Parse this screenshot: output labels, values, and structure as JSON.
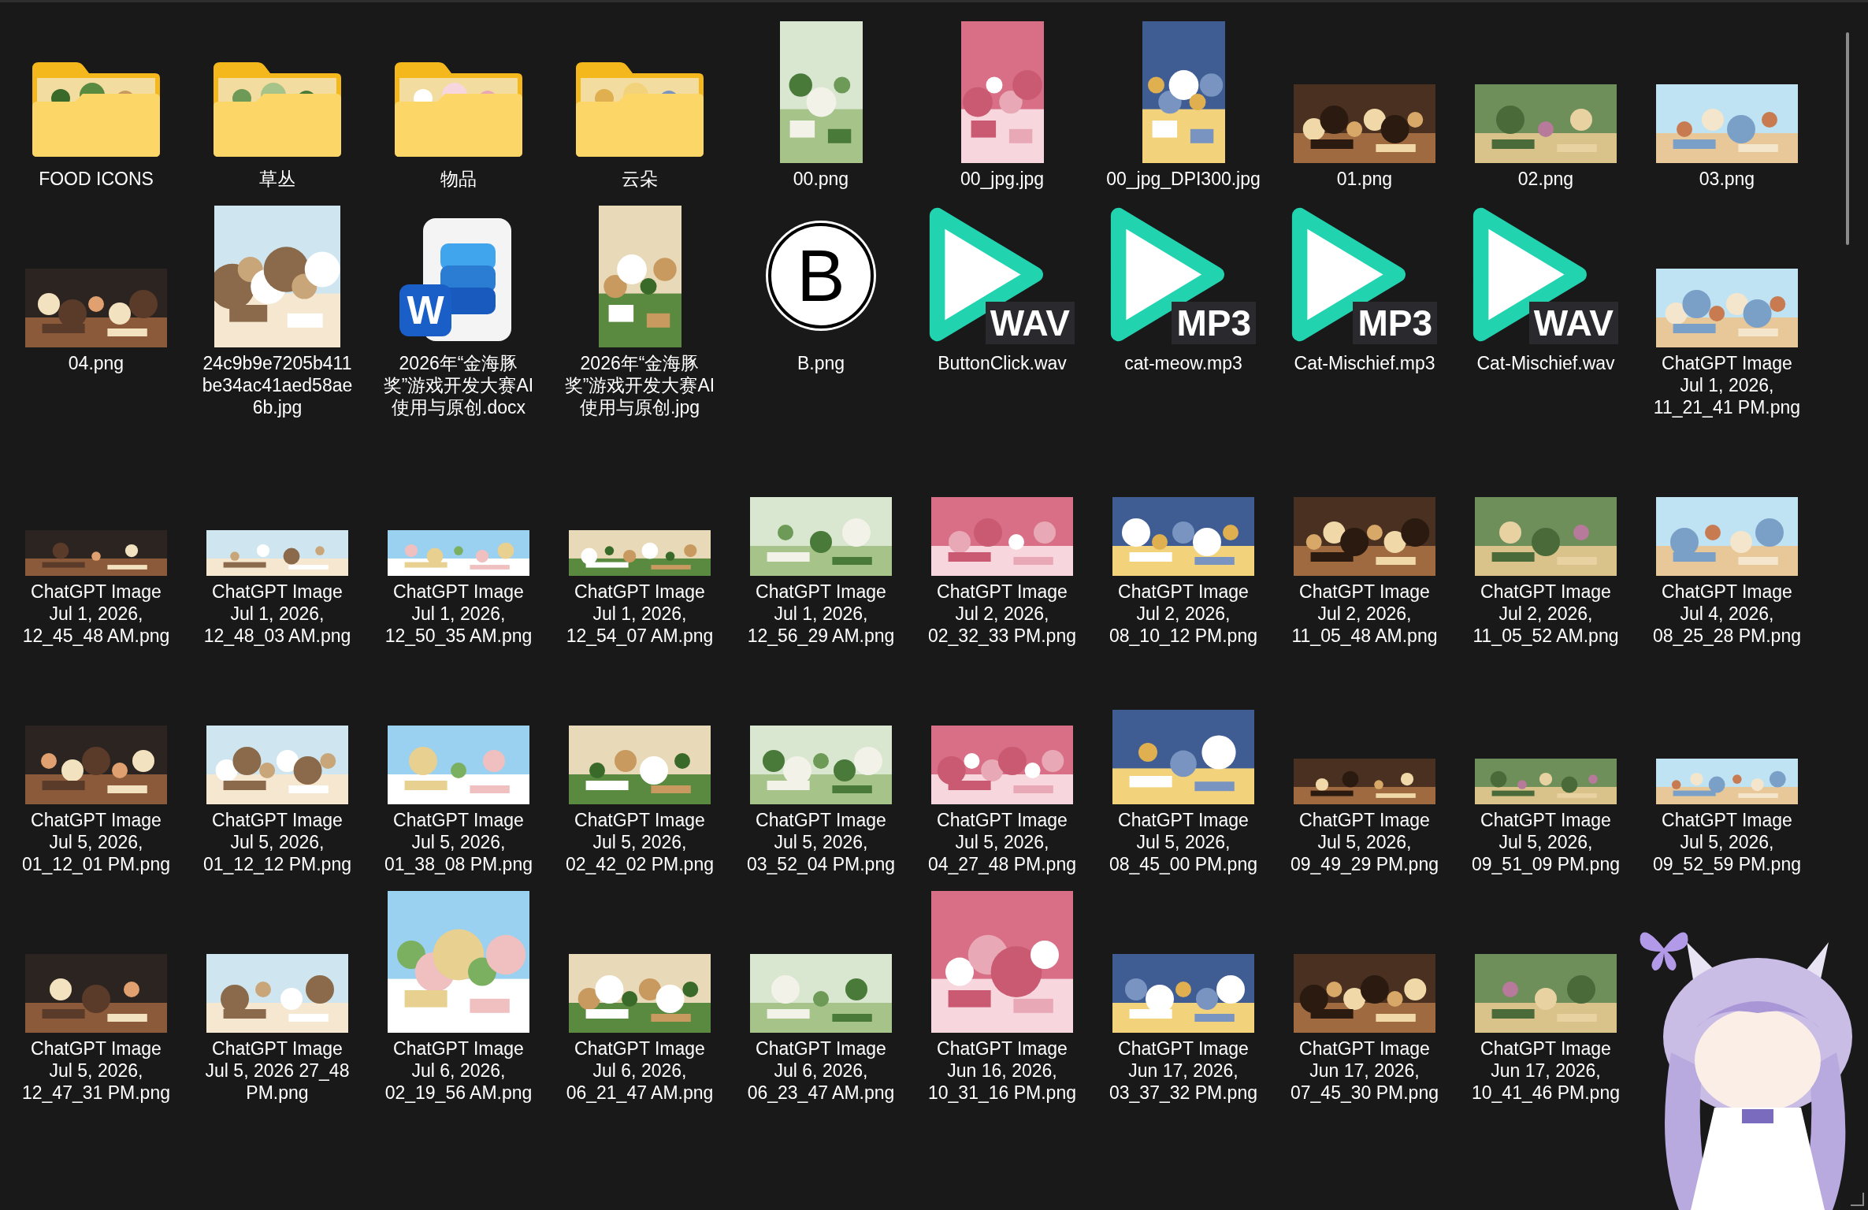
{
  "files": [
    {
      "kind": "folder",
      "name": "FOOD ICONS"
    },
    {
      "kind": "folder",
      "name": "草丛"
    },
    {
      "kind": "folder",
      "name": "物品"
    },
    {
      "kind": "folder",
      "name": "云朵"
    },
    {
      "kind": "picture",
      "name": "00.png"
    },
    {
      "kind": "picture",
      "name": "00_jpg.jpg"
    },
    {
      "kind": "picture",
      "name": "00_jpg_DPI300.jpg"
    },
    {
      "kind": "picture",
      "name": "01.png"
    },
    {
      "kind": "picture",
      "name": "02.png"
    },
    {
      "kind": "picture",
      "name": "03.png"
    },
    {
      "kind": "picture",
      "name": "04.png"
    },
    {
      "kind": "picture",
      "name": "24c9b9e7205b411be34ac41aed58ae6b.jpg"
    },
    {
      "kind": "document",
      "name": "2026年“金海豚奖”游戏开发大赛AI使用与原创.docx",
      "letter": "W"
    },
    {
      "kind": "picture",
      "name": "2026年“金海豚奖”游戏开发大赛AI使用与原创.jpg"
    },
    {
      "kind": "letter",
      "name": "B.png",
      "letter": "B"
    },
    {
      "kind": "audio",
      "name": "ButtonClick.wav",
      "tag": "WAV"
    },
    {
      "kind": "audio",
      "name": "cat-meow.mp3",
      "tag": "MP3"
    },
    {
      "kind": "audio",
      "name": "Cat-Mischief.mp3",
      "tag": "MP3"
    },
    {
      "kind": "audio",
      "name": "Cat-Mischief.wav",
      "tag": "WAV"
    },
    {
      "kind": "picture",
      "name": "ChatGPT Image Jul 1, 2026, 11_21_41 PM.png"
    },
    {
      "kind": "picture",
      "name": "ChatGPT Image Jul 1, 2026, 12_45_48 AM.png"
    },
    {
      "kind": "picture",
      "name": "ChatGPT Image Jul 1, 2026, 12_48_03 AM.png"
    },
    {
      "kind": "picture",
      "name": "ChatGPT Image Jul 1, 2026, 12_50_35 AM.png"
    },
    {
      "kind": "picture",
      "name": "ChatGPT Image Jul 1, 2026, 12_54_07 AM.png"
    },
    {
      "kind": "picture",
      "name": "ChatGPT Image Jul 1, 2026, 12_56_29 AM.png"
    },
    {
      "kind": "picture",
      "name": "ChatGPT Image Jul 2, 2026, 02_32_33 PM.png"
    },
    {
      "kind": "picture",
      "name": "ChatGPT Image Jul 2, 2026, 08_10_12 PM.png"
    },
    {
      "kind": "picture",
      "name": "ChatGPT Image Jul 2, 2026, 11_05_48 AM.png"
    },
    {
      "kind": "picture",
      "name": "ChatGPT Image Jul 2, 2026, 11_05_52 AM.png"
    },
    {
      "kind": "picture",
      "name": "ChatGPT Image Jul 4, 2026, 08_25_28 PM.png"
    },
    {
      "kind": "picture",
      "name": "ChatGPT Image Jul 5, 2026, 01_12_01 PM.png"
    },
    {
      "kind": "picture",
      "name": "ChatGPT Image Jul 5, 2026, 01_12_12 PM.png"
    },
    {
      "kind": "picture",
      "name": "ChatGPT Image Jul 5, 2026, 01_38_08 PM.png"
    },
    {
      "kind": "picture",
      "name": "ChatGPT Image Jul 5, 2026, 02_42_02 PM.png"
    },
    {
      "kind": "picture",
      "name": "ChatGPT Image Jul 5, 2026, 03_52_04 PM.png"
    },
    {
      "kind": "picture",
      "name": "ChatGPT Image Jul 5, 2026, 04_27_48 PM.png"
    },
    {
      "kind": "picture",
      "name": "ChatGPT Image Jul 5, 2026, 08_45_00 PM.png"
    },
    {
      "kind": "picture",
      "name": "ChatGPT Image Jul 5, 2026, 09_49_29 PM.png"
    },
    {
      "kind": "picture",
      "name": "ChatGPT Image Jul 5, 2026, 09_51_09 PM.png"
    },
    {
      "kind": "picture",
      "name": "ChatGPT Image Jul 5, 2026, 09_52_59 PM.png"
    },
    {
      "kind": "picture",
      "name": "ChatGPT Image Jul 5, 2026, 12_47_31 PM.png"
    },
    {
      "kind": "picture",
      "name": "ChatGPT Image Jul 5, 2026 27_48 PM.png"
    },
    {
      "kind": "picture",
      "name": "ChatGPT Image Jul 6, 2026, 02_19_56 AM.png"
    },
    {
      "kind": "picture",
      "name": "ChatGPT Image Jul 6, 2026, 06_21_47 AM.png"
    },
    {
      "kind": "picture",
      "name": "ChatGPT Image Jul 6, 2026, 06_23_47 AM.png"
    },
    {
      "kind": "picture",
      "name": "ChatGPT Image Jun 16, 2026, 10_31_16 PM.png"
    },
    {
      "kind": "picture",
      "name": "ChatGPT Image Jun 17, 2026, 03_37_32 PM.png"
    },
    {
      "kind": "picture",
      "name": "ChatGPT Image Jun 17, 2026, 07_45_30 PM.png"
    },
    {
      "kind": "picture",
      "name": "ChatGPT Image Jun 17, 2026, 10_41_46 PM.png"
    }
  ]
}
